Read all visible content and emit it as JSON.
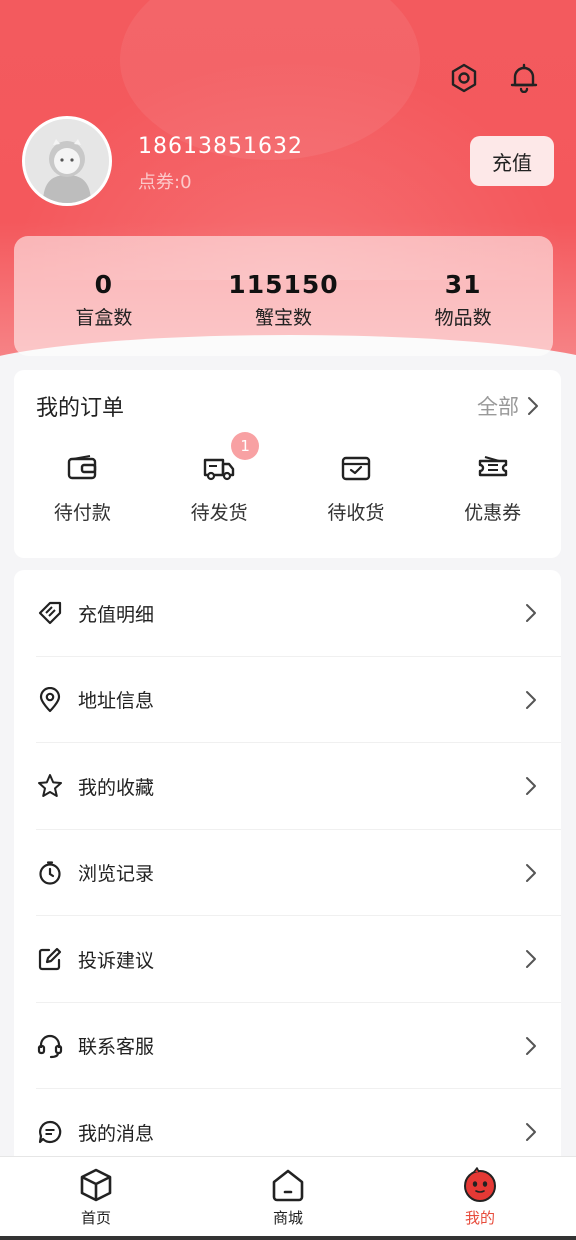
{
  "header": {
    "icons": [
      "settings-icon",
      "bell-icon"
    ]
  },
  "user": {
    "phone": "18613851632",
    "points": "点券:0",
    "recharge_label": "充值"
  },
  "stats": [
    {
      "value": "0",
      "label": "盲盒数"
    },
    {
      "value": "115150",
      "label": "蟹宝数"
    },
    {
      "value": "31",
      "label": "物品数"
    }
  ],
  "orders": {
    "title": "我的订单",
    "all_label": "全部",
    "items": [
      {
        "label": "待付款",
        "icon": "wallet-icon"
      },
      {
        "label": "待发货",
        "icon": "truck-icon",
        "badge": "1"
      },
      {
        "label": "待收货",
        "icon": "box-icon"
      },
      {
        "label": "优惠券",
        "icon": "ticket-icon"
      }
    ]
  },
  "menu": [
    {
      "label": "充值明细",
      "icon": "tag-icon"
    },
    {
      "label": "地址信息",
      "icon": "location-icon"
    },
    {
      "label": "我的收藏",
      "icon": "star-icon"
    },
    {
      "label": "浏览记录",
      "icon": "clock-icon"
    },
    {
      "label": "投诉建议",
      "icon": "edit-icon"
    },
    {
      "label": "联系客服",
      "icon": "headset-icon"
    },
    {
      "label": "我的消息",
      "icon": "chat-icon"
    }
  ],
  "tabbar": [
    {
      "label": "首页",
      "icon": "cube-icon"
    },
    {
      "label": "商城",
      "icon": "shop-icon"
    },
    {
      "label": "我的",
      "icon": "profile-icon",
      "active": true
    }
  ],
  "colors": {
    "brand": "#f4585c",
    "active_tab": "#e74c3c",
    "badge": "#f8a1a3"
  }
}
